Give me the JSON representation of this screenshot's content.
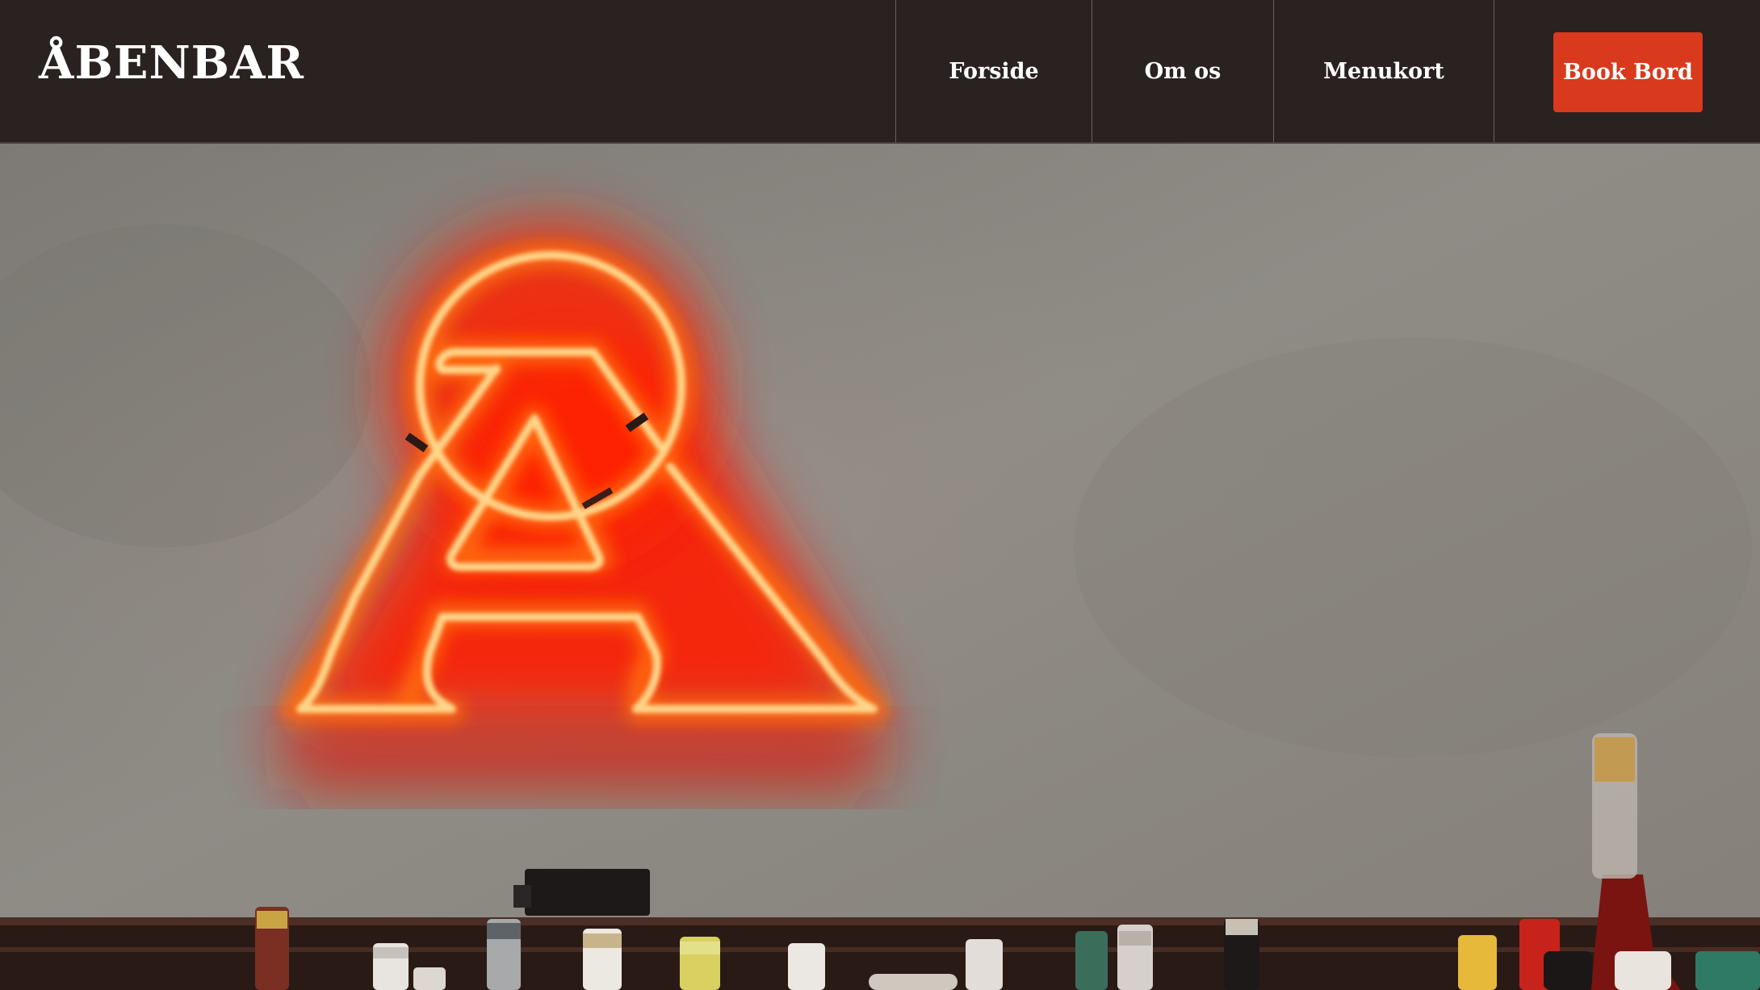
{
  "brand": {
    "name": "ÅBENBAR"
  },
  "nav": {
    "items": [
      {
        "label": "Forside"
      },
      {
        "label": "Om os"
      },
      {
        "label": "Menukort"
      }
    ],
    "cta_label": "Book Bord"
  },
  "colors": {
    "header_bg": "#2a2121",
    "accent": "#d9391c",
    "neon": "#ff2a10",
    "wall": "#8d8a84"
  },
  "hero": {
    "image": "neon-a-sign-over-bar-shelf"
  }
}
